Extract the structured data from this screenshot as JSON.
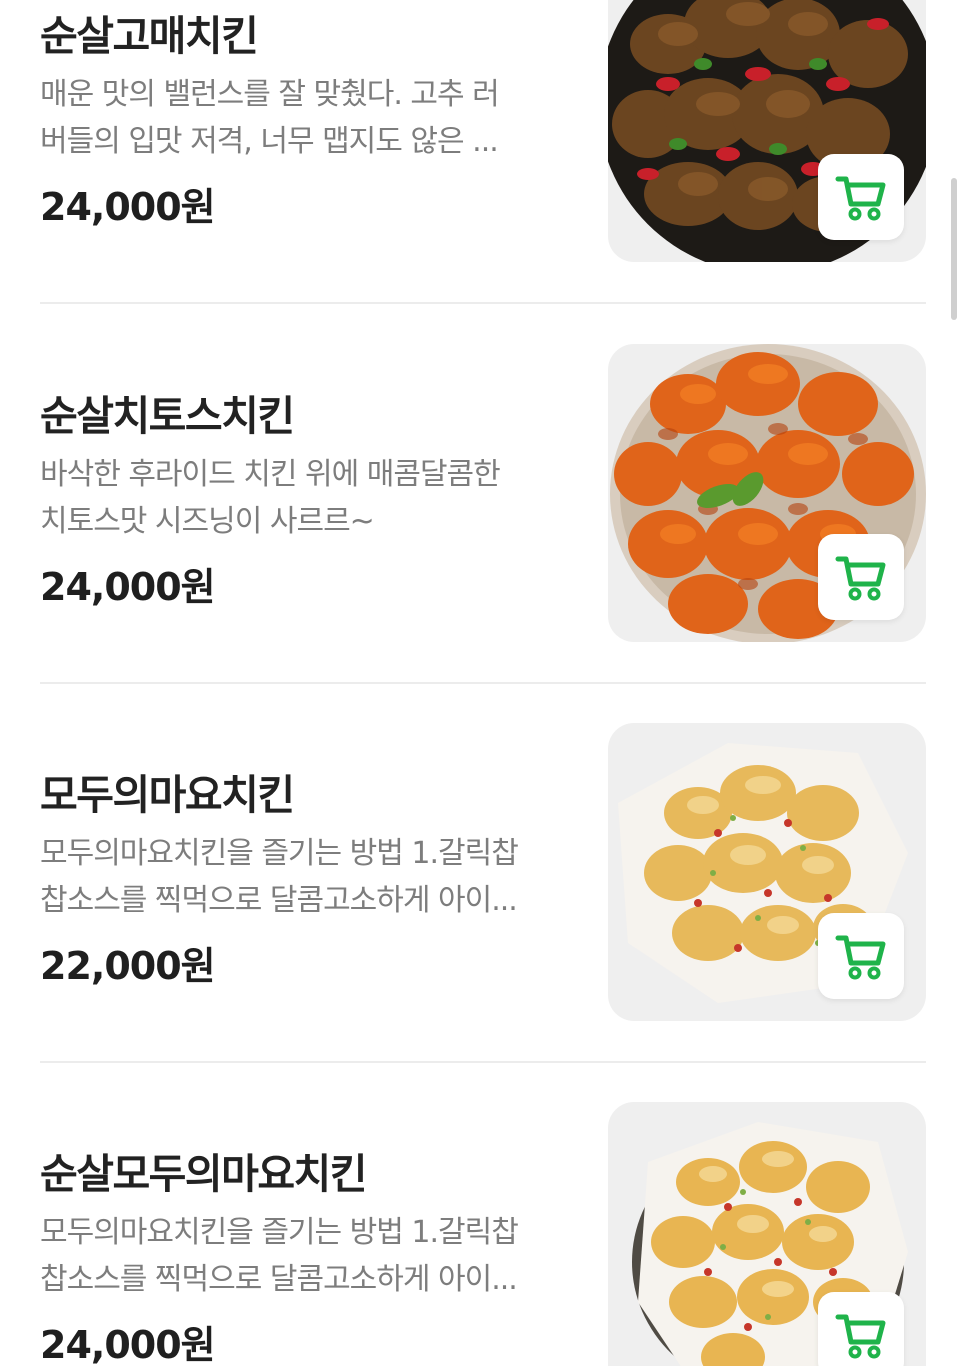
{
  "menu": {
    "items": [
      {
        "name": "순살고매치킨",
        "desc_line1": "매운 맛의 밸런스를 잘 맞췄다. 고추 러",
        "desc_line2": "버들의 입맛 저격, 너무 맵지도 않은 ...",
        "price": "24,000원",
        "dish": "glazed-spicy-chicken"
      },
      {
        "name": "순살치토스치킨",
        "desc_line1": "바삭한 후라이드 치킨 위에 매콤달콤한",
        "desc_line2": "치토스맛 시즈닝이 사르르~",
        "price": "24,000원",
        "dish": "orange-seasoned-chicken"
      },
      {
        "name": "모두의마요치킨",
        "desc_line1": "모두의마요치킨을 즐기는 방법 1.갈릭찹",
        "desc_line2": "찹소스를 찍먹으로 달콤고소하게 아이...",
        "price": "22,000원",
        "dish": "mayo-chicken"
      },
      {
        "name": "순살모두의마요치킨",
        "desc_line1": "모두의마요치킨을 즐기는 방법 1.갈릭찹",
        "desc_line2": "찹소스를 찍먹으로 달콤고소하게 아이...",
        "price": "24,000원",
        "dish": "boneless-mayo-chicken"
      }
    ]
  },
  "icons": {
    "cart": "cart-icon"
  },
  "colors": {
    "accent": "#1fb34a",
    "title": "#222222",
    "description": "#7d7d7d",
    "thumb_bg": "#efefef",
    "divider": "#ececec"
  }
}
